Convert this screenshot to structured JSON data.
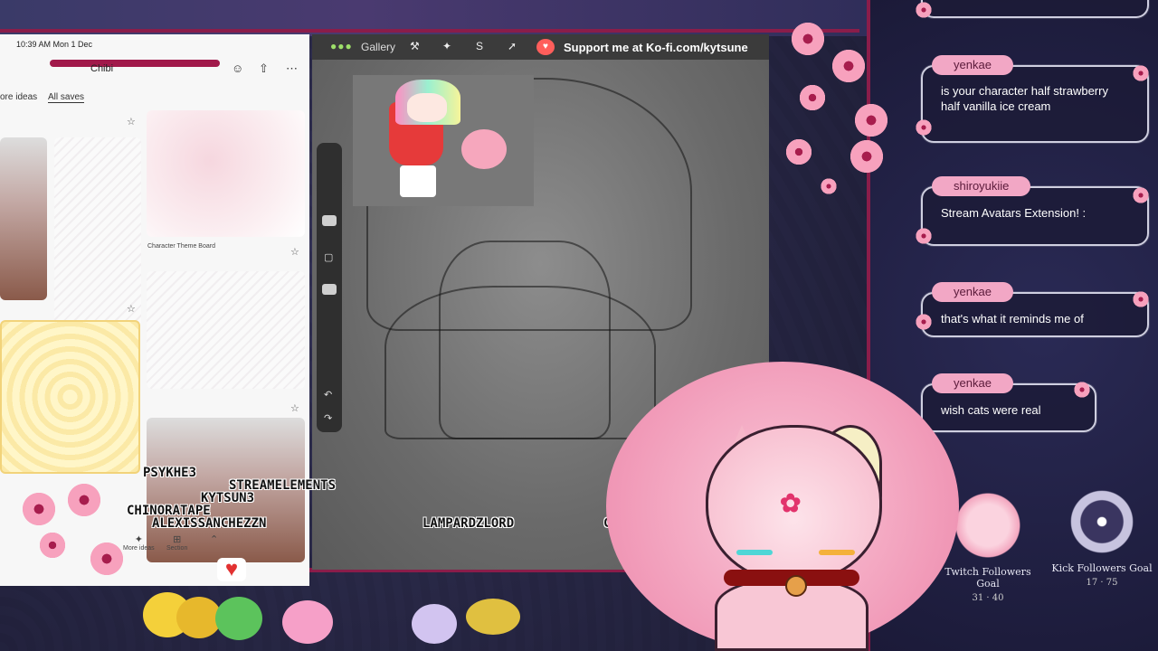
{
  "pinterest": {
    "status_time": "10:39 AM  Mon 1 Dec",
    "board_title": "Chibi",
    "tab_more_ideas": "ore ideas",
    "tab_all_saves": "All saves",
    "caption": "Character Theme Board",
    "nav": [
      {
        "icon": "add-icon",
        "label": "More ideas"
      },
      {
        "icon": "section-icon",
        "label": "Section"
      },
      {
        "icon": "organise-icon",
        "label": ""
      }
    ]
  },
  "procreate": {
    "gallery_label": "Gallery",
    "kofi_text": "Support me at Ko-fi.com/kytsune",
    "tools": [
      "wrench-icon",
      "magic-wand-icon",
      "selection-icon",
      "transform-icon"
    ]
  },
  "usernames": [
    "PSYKHE3",
    "STREAMELEMENTS",
    "KYTSUN3",
    "CHINORATAPE",
    "ALEXISSANCHEZZN",
    "LAMPARDZLORD",
    "CI"
  ],
  "chat": [
    {
      "user": "yenkae",
      "message": "is your character half strawberry half vanilla ice cream"
    },
    {
      "user": "shiroyukiie",
      "message": "Stream Avatars Extension! :"
    },
    {
      "user": "yenkae",
      "message": "that's what it reminds me of"
    },
    {
      "user": "yenkae",
      "message": "wish cats were real"
    }
  ],
  "goals": [
    {
      "label": "Twitch Followers Goal",
      "count": "31 · 40"
    },
    {
      "label": "Kick Followers Goal",
      "count": "17 · 75"
    }
  ],
  "colors": {
    "frame": "#8a1d4a",
    "chat_user_pill": "#f2a7c5",
    "blossom": "#f7a1bd",
    "kofi": "#ff5e5b"
  }
}
